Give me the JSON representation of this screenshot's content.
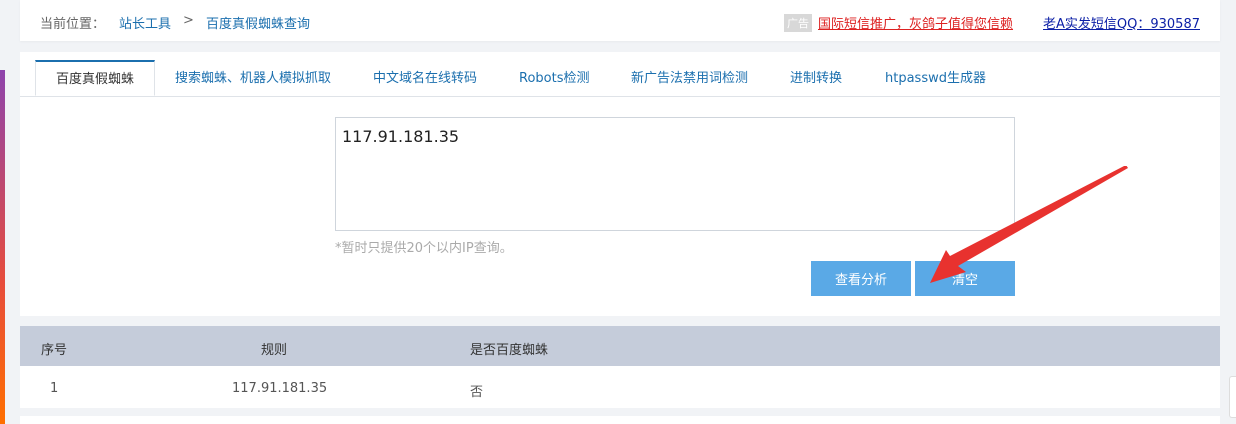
{
  "breadcrumb": {
    "prefix": "当前位置：",
    "items": [
      "站长工具",
      "百度真假蜘蛛查询"
    ],
    "separator": ">"
  },
  "ad": {
    "badge": "广告",
    "promo": "国际短信推广，灰鸽子值得您信赖",
    "qq": "老A实发短信QQ：930587"
  },
  "tabs": [
    {
      "label": "百度真假蜘蛛",
      "active": true
    },
    {
      "label": "搜索蜘蛛、机器人模拟抓取",
      "active": false
    },
    {
      "label": "中文域名在线转码",
      "active": false
    },
    {
      "label": "Robots检测",
      "active": false
    },
    {
      "label": "新广告法禁用词检测",
      "active": false
    },
    {
      "label": "进制转换",
      "active": false
    },
    {
      "label": "htpasswd生成器",
      "active": false
    }
  ],
  "input": {
    "value": "117.91.181.35"
  },
  "hint": "*暂时只提供20个以内IP查询。",
  "buttons": {
    "analyze": "查看分析",
    "clear": "清空"
  },
  "table": {
    "headers": [
      "序号",
      "规则",
      "是否百度蜘蛛"
    ],
    "rows": [
      [
        "1",
        "117.91.181.35",
        "否"
      ]
    ]
  },
  "colors": {
    "accent": "#1b6fae",
    "button": "#5aa9e6",
    "header_bg": "#c5ccda",
    "ad_red": "#dd2222",
    "arrow": "#e8322f"
  }
}
